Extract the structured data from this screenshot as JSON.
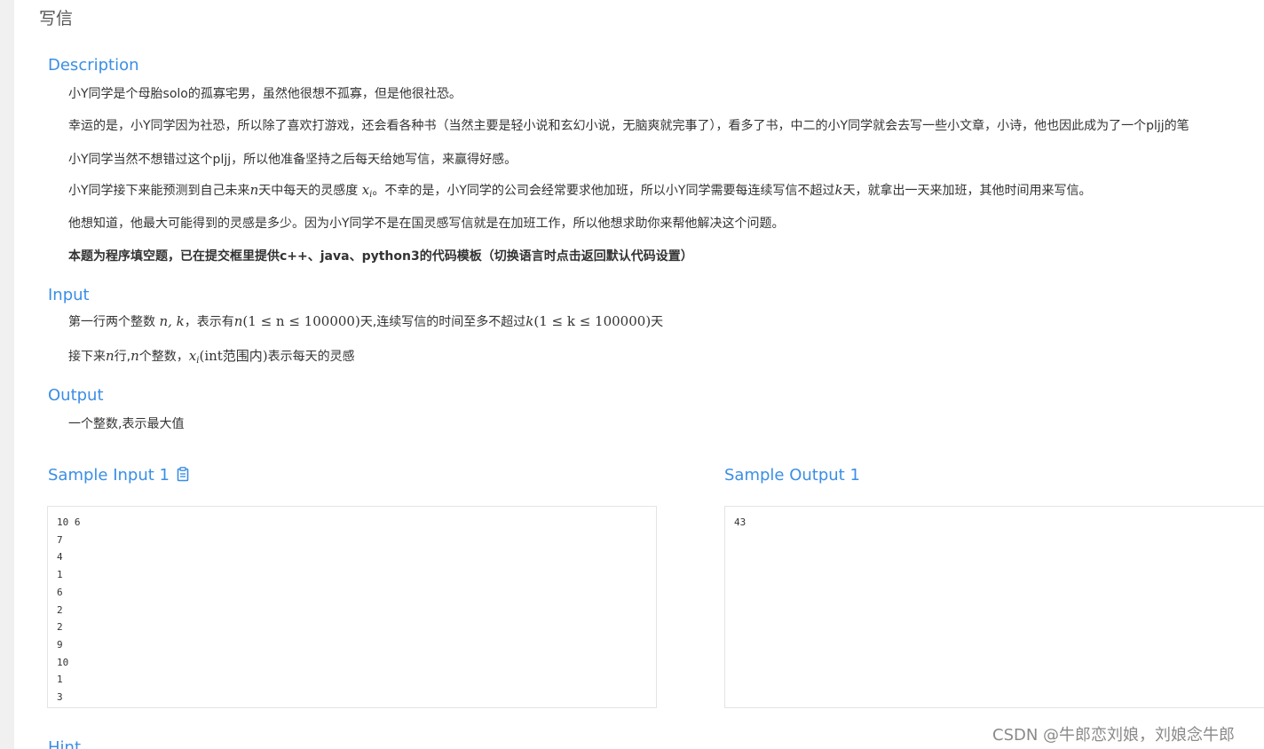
{
  "problem": {
    "title": "写信"
  },
  "description": {
    "heading": "Description",
    "p1": "小Y同学是个母胎solo的孤寡宅男，虽然他很想不孤寡，但是他很社恐。",
    "p2": "幸运的是，小Y同学因为社恐，所以除了喜欢打游戏，还会看各种书（当然主要是轻小说和玄幻小说，无脑爽就完事了），看多了书，中二的小Y同学就会去写一些小文章，小诗，他也因此成为了一个pljj的笔",
    "p3": "小Y同学当然不想错过这个pljj，所以他准备坚持之后每天给她写信，来赢得好感。",
    "p4_a": "小Y同学接下来能预测到自己未来",
    "p4_n": "n",
    "p4_b": "天中每天的灵感度 ",
    "p4_x": "x",
    "p4_i": "i",
    "p4_c": "。不幸的是，小Y同学的公司会经常要求他加班，所以小Y同学需要每连续写信不超过",
    "p4_k": "k",
    "p4_d": "天，就拿出一天来加班，其他时间用来写信。",
    "p5": "他想知道，他最大可能得到的灵感是多少。因为小Y同学不是在国灵感写信就是在加班工作，所以他想求助你来帮他解决这个问题。",
    "p6": "本题为程序填空题，已在提交框里提供c++、java、python3的代码模板（切换语言时点击返回默认代码设置）"
  },
  "input": {
    "heading": "Input",
    "l1_a": "第一行两个整数 ",
    "l1_nk": "n, k",
    "l1_b": "，表示有",
    "l1_n": "n",
    "l1_range_n": "(1 ≤ n ≤ 100000)",
    "l1_c": "天,连续写信的时间至多不超过",
    "l1_k": "k",
    "l1_range_k": "(1 ≤ k ≤ 100000)",
    "l1_d": "天",
    "l2_a": "接下来",
    "l2_n1": "n",
    "l2_b": "行,",
    "l2_n2": "n",
    "l2_c": "个整数，",
    "l2_x": "x",
    "l2_i": "i",
    "l2_paren": "(int范围内)",
    "l2_d": "表示每天的灵感"
  },
  "output": {
    "heading": "Output",
    "text": "一个整数,表示最大值"
  },
  "sample_input": {
    "heading": "Sample Input 1",
    "copy_icon": "clipboard-icon",
    "content": "10 6\n7\n4\n1\n6\n2\n2\n9\n10\n1\n3"
  },
  "sample_output": {
    "heading": "Sample Output 1",
    "content": "43"
  },
  "hint": {
    "heading": "Hint"
  },
  "watermark": {
    "text": "CSDN @牛郎恋刘娘，刘娘念牛郎"
  },
  "colors": {
    "accent": "#3a8ee6",
    "text": "#333333",
    "border": "#e4e4e4"
  }
}
